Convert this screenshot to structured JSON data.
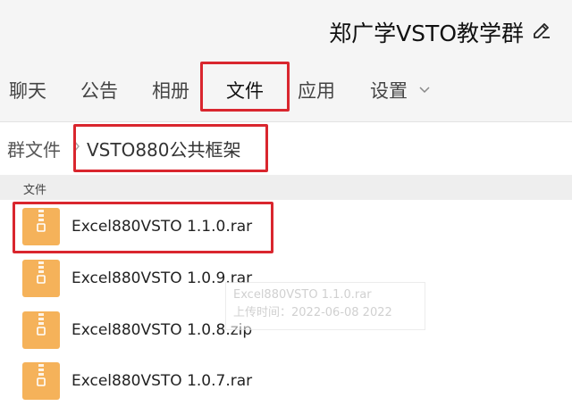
{
  "header": {
    "group_title": "郑广学VSTO教学群",
    "icons": {
      "edit": "pencil-icon",
      "settings_menu": "chevron-down-icon"
    }
  },
  "tabs": [
    {
      "label": "聊天",
      "active": false
    },
    {
      "label": "公告",
      "active": false
    },
    {
      "label": "相册",
      "active": false
    },
    {
      "label": "文件",
      "active": true
    },
    {
      "label": "应用",
      "active": false
    },
    {
      "label": "设置",
      "active": false,
      "has_dropdown": true
    }
  ],
  "breadcrumb": {
    "root": "群文件",
    "separator_icon": "chevron-right-icon",
    "current": "VSTO880公共框架"
  },
  "file_list": {
    "column_header": "文件",
    "files": [
      {
        "name": "Excel880VSTO 1.1.0.rar",
        "icon": "zip-archive-icon"
      },
      {
        "name": "Excel880VSTO 1.0.9.rar",
        "icon": "zip-archive-icon"
      },
      {
        "name": "Excel880VSTO 1.0.8.zip",
        "icon": "zip-archive-icon"
      },
      {
        "name": "Excel880VSTO 1.0.7.rar",
        "icon": "zip-archive-icon"
      }
    ]
  },
  "tooltip": {
    "line1": "Excel880VSTO 1.1.0.rar",
    "line2": "上传时间：2022-06-08 2022"
  },
  "colors": {
    "highlight": "#d9262e",
    "archive_icon": "#f5b25a",
    "header_bg": "#f5f5f5"
  }
}
